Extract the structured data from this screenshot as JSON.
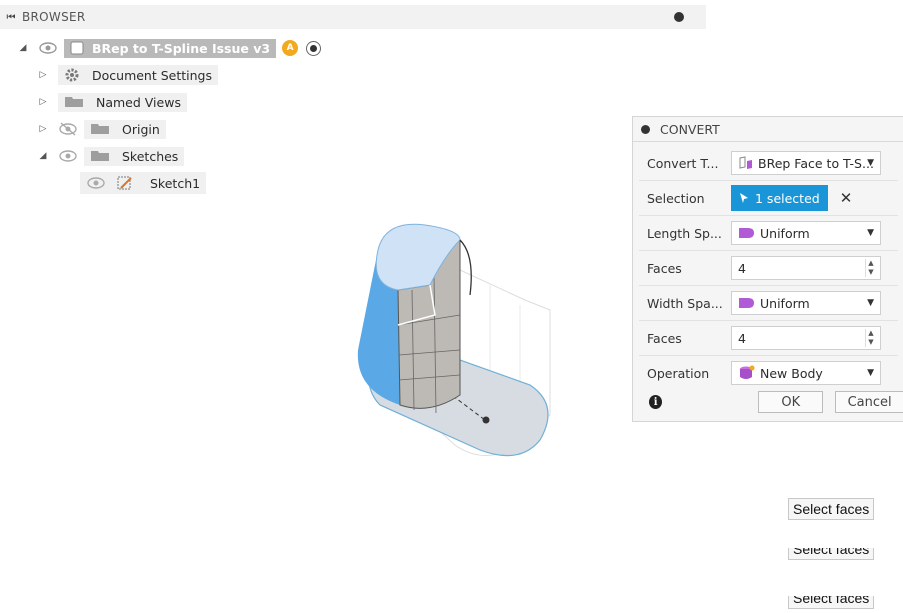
{
  "browser": {
    "header_title": "BROWSER",
    "root": {
      "label": "BRep to T-Spline Issue v3",
      "badge": "A"
    },
    "items": [
      {
        "label": "Document Settings"
      },
      {
        "label": "Named Views"
      },
      {
        "label": "Origin"
      },
      {
        "label": "Sketches"
      },
      {
        "label": "Sketch1"
      }
    ]
  },
  "convert": {
    "title": "CONVERT",
    "rows": {
      "convert_type": {
        "label": "Convert T...",
        "value": "BRep Face to T-S..."
      },
      "selection": {
        "label": "Selection",
        "value": "1 selected"
      },
      "length_spacing": {
        "label": "Length Sp...",
        "value": "Uniform"
      },
      "length_faces": {
        "label": "Faces",
        "value": "4"
      },
      "width_spacing": {
        "label": "Width Spa...",
        "value": "Uniform"
      },
      "width_faces": {
        "label": "Faces",
        "value": "4"
      },
      "operation": {
        "label": "Operation",
        "value": "New Body"
      }
    },
    "ok_label": "OK",
    "cancel_label": "Cancel"
  },
  "tooltips": [
    "Select faces",
    "Select faces",
    "Select faces"
  ],
  "colors": {
    "accent": "#1a96d8",
    "selected_face": "#5aa9e6"
  }
}
